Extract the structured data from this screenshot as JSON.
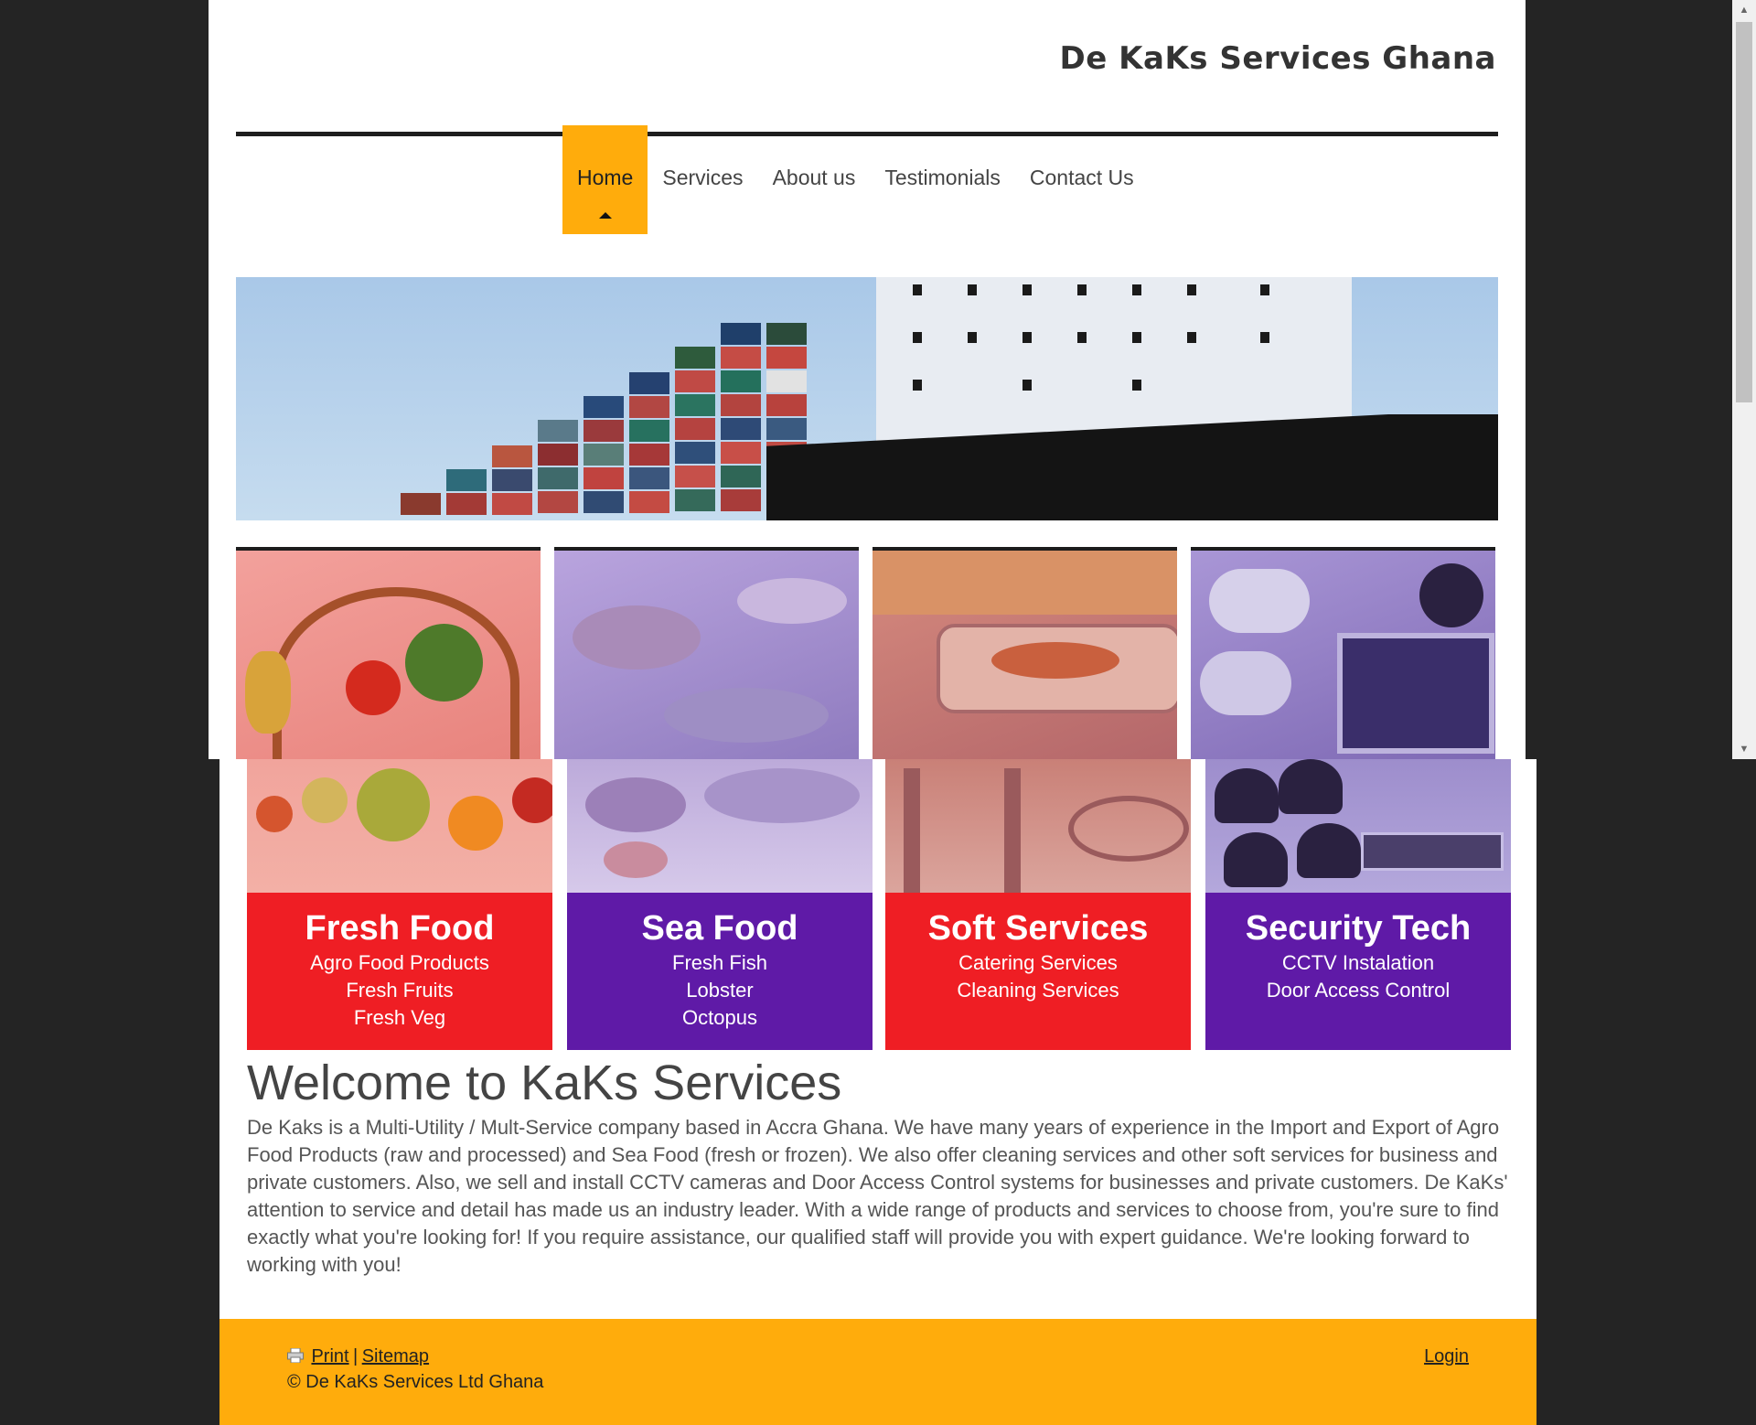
{
  "site": {
    "title": "De KaKs Services Ghana"
  },
  "nav": [
    {
      "label": "Home",
      "active": true
    },
    {
      "label": "Services"
    },
    {
      "label": "About us"
    },
    {
      "label": "Testimonials"
    },
    {
      "label": "Contact Us"
    }
  ],
  "tiles": [
    {
      "title": "Fresh Food",
      "lines": [
        "Agro Food Products",
        "Fresh Fruits",
        "Fresh Veg"
      ],
      "color": "#ef1e24"
    },
    {
      "title": "Sea Food",
      "lines": [
        "Fresh Fish",
        "Lobster",
        "Octopus"
      ],
      "color": "#5f1aa7"
    },
    {
      "title": "Soft Services",
      "lines": [
        "Catering Services",
        "Cleaning Services"
      ],
      "color": "#ef1e24"
    },
    {
      "title": "Security Tech",
      "lines": [
        "CCTV Instalation",
        "Door Access Control"
      ],
      "color": "#5f1aa7"
    }
  ],
  "welcome": {
    "heading": "Welcome to KaKs Services",
    "text": "De Kaks is a Multi-Utility / Mult-Service company based in Accra Ghana. We have many years of experience in the Import and Export of Agro Food Products (raw and processed) and Sea Food (fresh or frozen). We also offer cleaning services and other soft services for business and private customers. Also, we sell and install CCTV cameras and Door Access Control systems for businesses and private customers. De KaKs' attention to service and detail has made us an industry leader. With a wide range of products and services to choose from, you're sure to find exactly what you're looking for! If you require assistance, our qualified staff will provide you with expert guidance. We're looking forward to working with you!"
  },
  "footer": {
    "print": "Print",
    "separator": "|",
    "sitemap": "Sitemap",
    "copyright": "© De KaKs Services Ltd Ghana",
    "login": "Login"
  },
  "colors": {
    "accent": "#ffac0c",
    "red": "#ef1e24",
    "purple": "#5f1aa7"
  },
  "icons": {
    "print": "printer-icon"
  }
}
